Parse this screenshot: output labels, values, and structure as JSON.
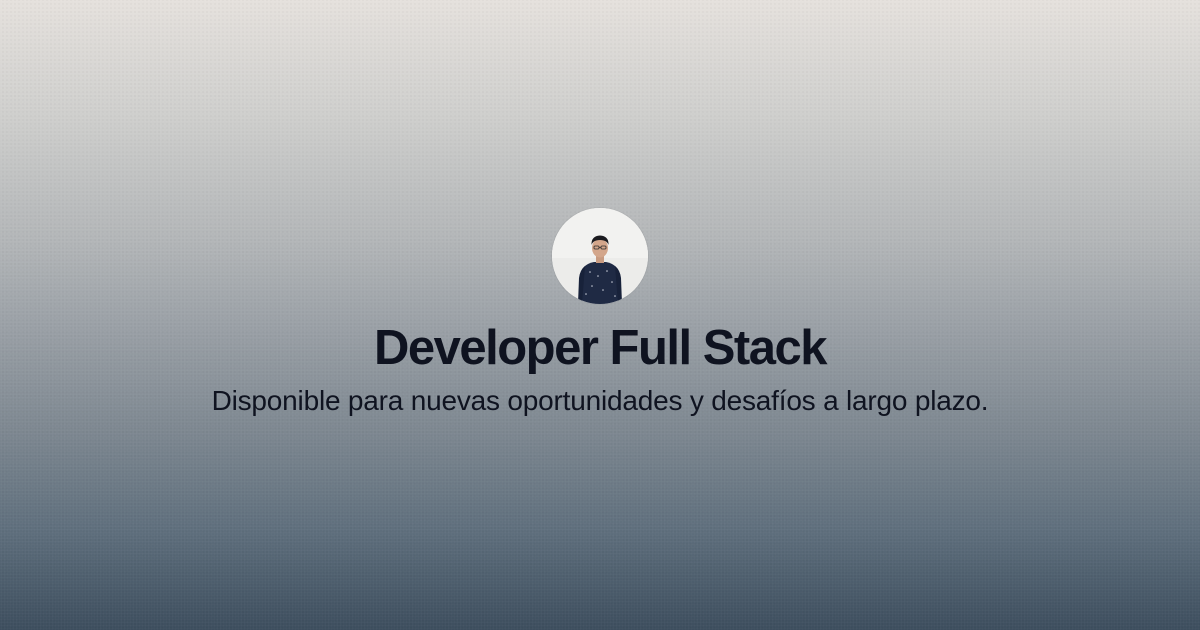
{
  "profile": {
    "avatar_alt": "avatar",
    "title": "Developer Full Stack",
    "subtitle": "Disponible para nuevas oportunidades y desafíos a largo plazo."
  },
  "colors": {
    "text": "#0f1320",
    "background_top": "#e5e1dd",
    "background_bottom": "#3d4e5e"
  }
}
